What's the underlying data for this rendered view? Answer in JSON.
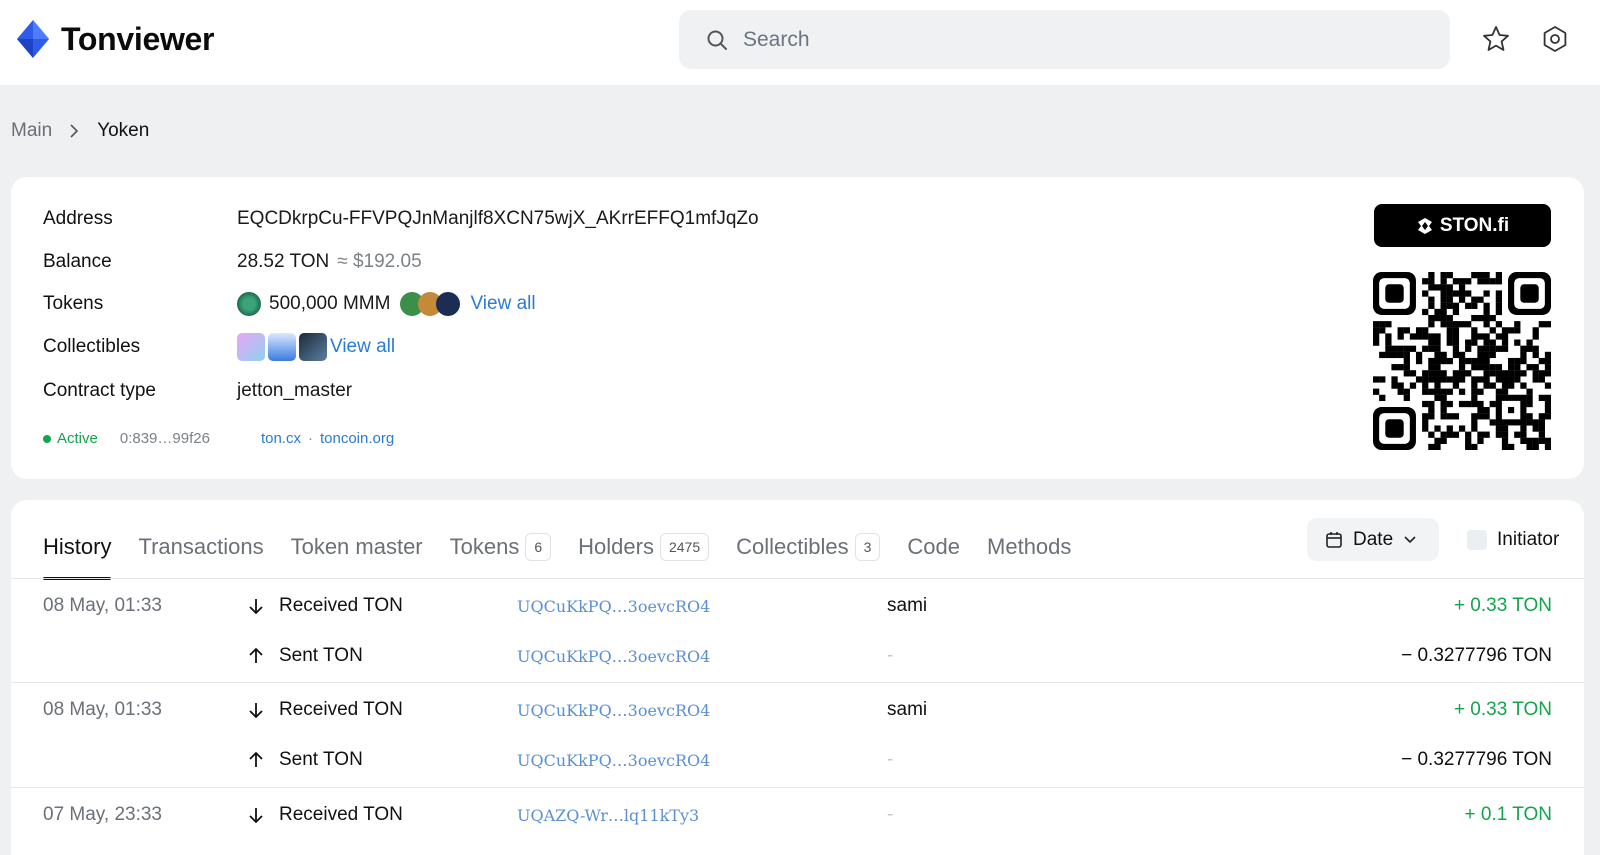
{
  "app": {
    "name": "Tonviewer"
  },
  "search": {
    "placeholder": "Search"
  },
  "breadcrumb": {
    "root": "Main",
    "current": "Yoken"
  },
  "account": {
    "address_label": "Address",
    "address": "EQCDkrpCu-FFVPQJnManjlf8XCN75wjX_AKrrEFFQ1mfJqZo",
    "balance_label": "Balance",
    "balance": "28.52 TON",
    "balance_usd": "≈ $192.05",
    "tokens_label": "Tokens",
    "tokens_main": "500,000 MMM",
    "tokens_view_all": "View all",
    "collectibles_label": "Collectibles",
    "collectibles_view_all": "View all",
    "contract_label": "Contract type",
    "contract_type": "jetton_master",
    "status": "Active",
    "raw_address": "0:839…99f26",
    "sites": [
      "ton.cx",
      "toncoin.org"
    ],
    "site_sep": "·",
    "ston_label": "STON.fi"
  },
  "tabs": [
    {
      "label": "History",
      "count": ""
    },
    {
      "label": "Transactions",
      "count": ""
    },
    {
      "label": "Token master",
      "count": ""
    },
    {
      "label": "Tokens",
      "count": "6"
    },
    {
      "label": "Holders",
      "count": "2475"
    },
    {
      "label": "Collectibles",
      "count": "3"
    },
    {
      "label": "Code",
      "count": ""
    },
    {
      "label": "Methods",
      "count": ""
    }
  ],
  "filters": {
    "date": "Date",
    "initiator": "Initiator"
  },
  "history": [
    {
      "date": "08 May, 01:33",
      "actions": [
        {
          "type": "Received TON",
          "dir": "in",
          "address": "UQCuKkPQ…3oevcRO4",
          "counterparty": "sami",
          "amount": "+ 0.33 TON"
        },
        {
          "type": "Sent TON",
          "dir": "out",
          "address": "UQCuKkPQ…3oevcRO4",
          "counterparty": "-",
          "amount": "− 0.3277796 TON"
        }
      ]
    },
    {
      "date": "08 May, 01:33",
      "actions": [
        {
          "type": "Received TON",
          "dir": "in",
          "address": "UQCuKkPQ…3oevcRO4",
          "counterparty": "sami",
          "amount": "+ 0.33 TON"
        },
        {
          "type": "Sent TON",
          "dir": "out",
          "address": "UQCuKkPQ…3oevcRO4",
          "counterparty": "-",
          "amount": "− 0.3277796 TON"
        }
      ]
    },
    {
      "date": "07 May, 23:33",
      "actions": [
        {
          "type": "Received TON",
          "dir": "in",
          "address": "UQAZQ-Wr…lq11kTy3",
          "counterparty": "-",
          "amount": "+ 0.1 TON"
        }
      ]
    }
  ],
  "colors": {
    "accent": "#2a7bd6",
    "positive": "#14a44d",
    "logo": "#2d5bea"
  },
  "icons": {
    "search": "search-icon",
    "favorite": "star-icon",
    "settings": "settings-icon"
  }
}
